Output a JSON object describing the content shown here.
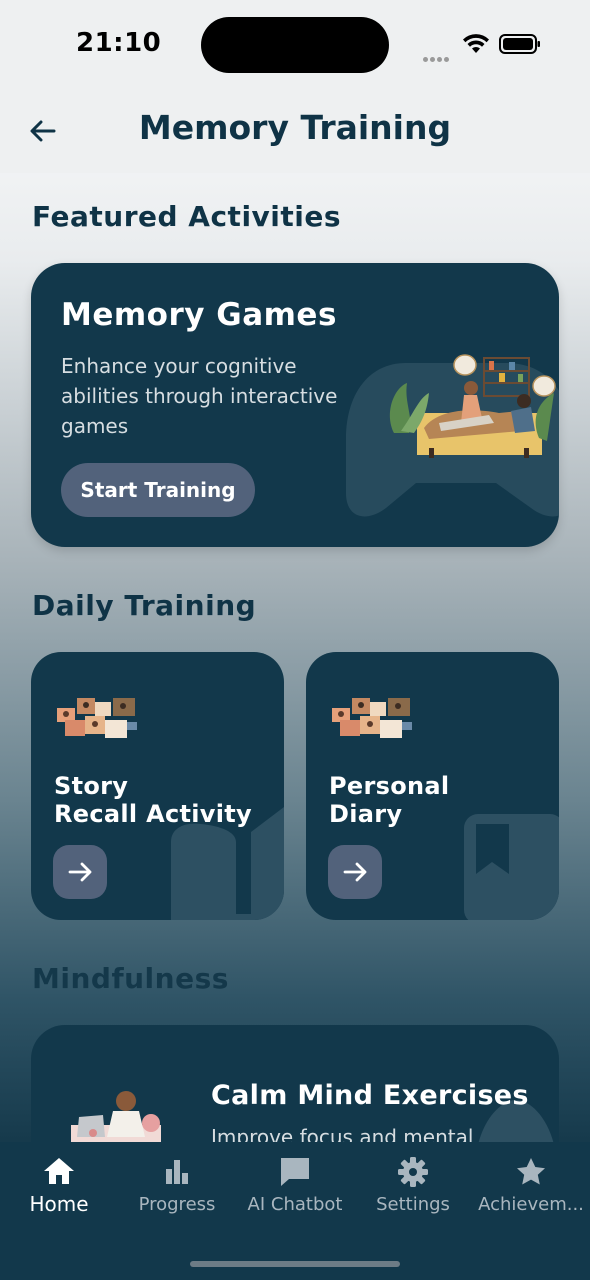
{
  "status_bar": {
    "time": "21:10"
  },
  "header": {
    "title": "Memory Training",
    "back_icon": "arrow-left-icon"
  },
  "featured": {
    "section_title": "Featured Activities",
    "card": {
      "title": "Memory Games",
      "description": "Enhance your cognitive abilities through interactive games",
      "button_label": "Start Training",
      "background_icon": "gamepad-icon"
    }
  },
  "daily": {
    "section_title": "Daily Training",
    "cards": [
      {
        "title_line1": "Story",
        "title_line2": "Recall Activity",
        "background_icon": "book-icon",
        "button_icon": "arrow-right-icon"
      },
      {
        "title_line1": "Personal",
        "title_line2": "Diary",
        "background_icon": "bookmark-icon",
        "button_icon": "arrow-right-icon"
      }
    ]
  },
  "mindfulness": {
    "section_title": "Mindfulness",
    "card": {
      "title": "Calm Mind Exercises",
      "description": "Improve focus and mental"
    }
  },
  "tab_bar": {
    "tabs": [
      {
        "label": "Home",
        "icon": "home-icon",
        "active": true
      },
      {
        "label": "Progress",
        "icon": "bar-chart-icon",
        "active": false
      },
      {
        "label": "AI Chatbot",
        "icon": "chat-bubble-icon",
        "active": false
      },
      {
        "label": "Settings",
        "icon": "gear-icon",
        "active": false
      },
      {
        "label": "Achievem...",
        "icon": "star-icon",
        "active": false
      }
    ]
  },
  "colors": {
    "primary": "#12384b",
    "button": "#52627b",
    "text": "#0f3346"
  }
}
